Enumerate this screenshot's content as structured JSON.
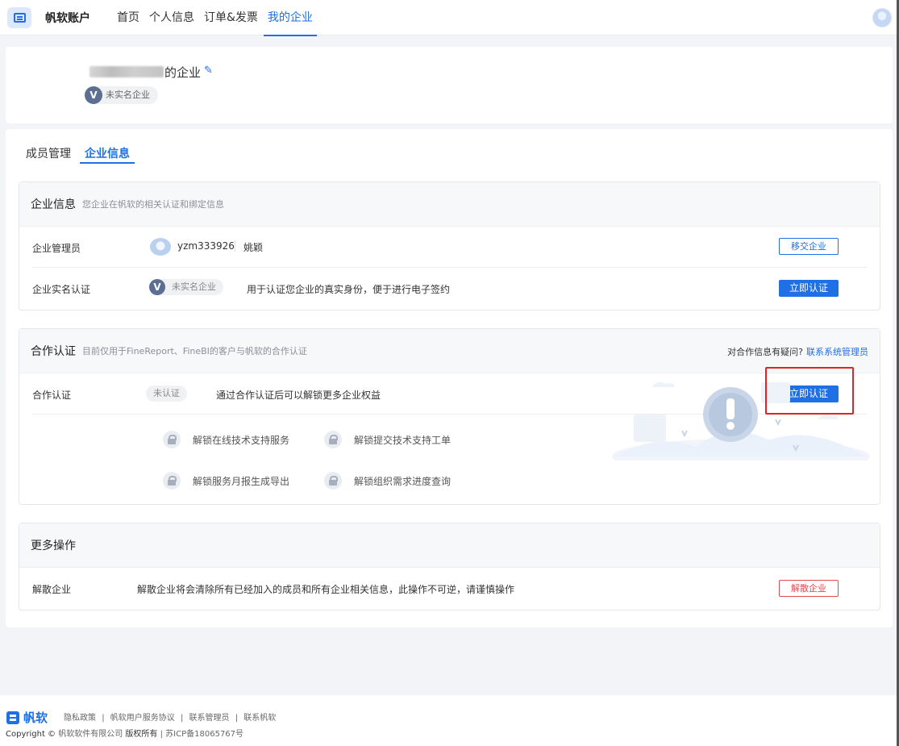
{
  "header": {
    "app_name": "帆软账户",
    "nav": [
      "首页",
      "个人信息",
      "订单&发票",
      "我的企业"
    ],
    "active_nav": "我的企业"
  },
  "company": {
    "name_suffix": "的企业",
    "realname_status": "未实名企业",
    "badge_letter": "V"
  },
  "tabs": [
    "成员管理",
    "企业信息"
  ],
  "enterprise_info": {
    "title": "企业信息",
    "desc": "您企业在帆软的相关认证和绑定信息",
    "admin_label": "企业管理员",
    "admin_id": "yzm333926",
    "admin_name": "姚颖",
    "transfer_button": "移交企业",
    "realname_label": "企业实名认证",
    "realname_status": "未实名企业",
    "realname_desc": "用于认证您企业的真实身份，便于进行电子签约",
    "certify_button": "立即认证"
  },
  "cooperation": {
    "title": "合作认证",
    "desc": "目前仅用于FineReport、FineBI的客户与帆软的合作认证",
    "question": "对合作信息有疑问?",
    "contact_link": "联系系统管理员",
    "row_label": "合作认证",
    "status": "未认证",
    "row_desc": "通过合作认证后可以解锁更多企业权益",
    "certify_button": "立即认证",
    "perks": [
      "解锁在线技术支持服务",
      "解锁提交技术支持工单",
      "解锁服务月报生成导出",
      "解锁组织需求进度查询"
    ]
  },
  "more": {
    "title": "更多操作",
    "dissolve_label": "解散企业",
    "dissolve_desc": "解散企业将会清除所有已经加入的成员和所有企业相关信息，此操作不可逆，请谨慎操作",
    "dissolve_button": "解散企业"
  },
  "footer": {
    "brand": "帆软",
    "links": [
      "隐私政策",
      "|",
      "帆软用户服务协议",
      "|",
      "联系管理员",
      "|",
      "联系帆软"
    ],
    "copyright": "Copyright ©",
    "company": "帆软软件有限公司",
    "rights": "版权所有",
    "sep": "|",
    "icp": "苏ICP备18065767号"
  },
  "colors": {
    "accent": "#1f6fe5",
    "danger": "#e5484d",
    "highlight": "#e02424"
  }
}
